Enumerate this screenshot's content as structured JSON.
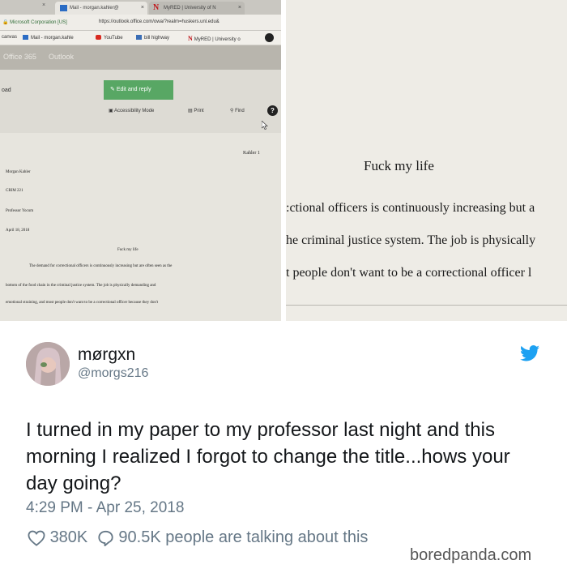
{
  "browser": {
    "tab_close_0": "×",
    "tabs": [
      {
        "label": "Mail - morgan.kahler@",
        "close": "×"
      },
      {
        "label": "MyRED | University of N",
        "close": "×"
      }
    ],
    "address": {
      "secure_label": "Microsoft Corporation [US]",
      "url": "https://outlook.office.com/owa/?realm=huskers.unl.edu&"
    },
    "bookmarks": [
      "canvas",
      "Mail - morgan.kahle",
      "YouTube",
      "bill highway",
      "MyRED | University o"
    ],
    "suite_bar": {
      "office": "Office 365",
      "app": "Outlook"
    },
    "mail": {
      "pad_text": "oad",
      "edit_reply_label": "Edit and reply",
      "accessibility_label": "Accessibility Mode",
      "print_label": "Print",
      "find_label": "Find",
      "help_label": "?"
    }
  },
  "paper_left": {
    "running_header": "Kahler 1",
    "author": "Morgan Kahler",
    "course": "CRIM 221",
    "professor": "Professor Yocum",
    "date": "April 18, 2018",
    "title": "Fuck my life",
    "lines": [
      "The demand for correctional officers is continuously increasing but are often seen as the",
      "bottom of the food chain in the criminal justice system. The job is physically demanding and",
      "emotional straining, and most people don't want to be a correctional officer because they don't"
    ]
  },
  "paper_right": {
    "title": "Fuck my life",
    "lines": [
      ":ctional officers is continuously increasing but a",
      "he criminal justice system. The job is physically",
      "t people don't want to be a correctional officer l"
    ]
  },
  "tweet": {
    "display_name": "mørgxn",
    "handle": "@morgs216",
    "text": "I turned in my paper to my professor last night and this morning I realized I forgot to change the title...hows your day going?",
    "timestamp": "4:29 PM - Apr 25, 2018",
    "likes": "380K",
    "replies": "90.5K people are talking about this",
    "colors": {
      "text": "#14171a",
      "muted": "#657786",
      "twitter_blue": "#1da1f2",
      "edit_button_green": "#58a764"
    }
  },
  "watermark": "boredpanda.com"
}
